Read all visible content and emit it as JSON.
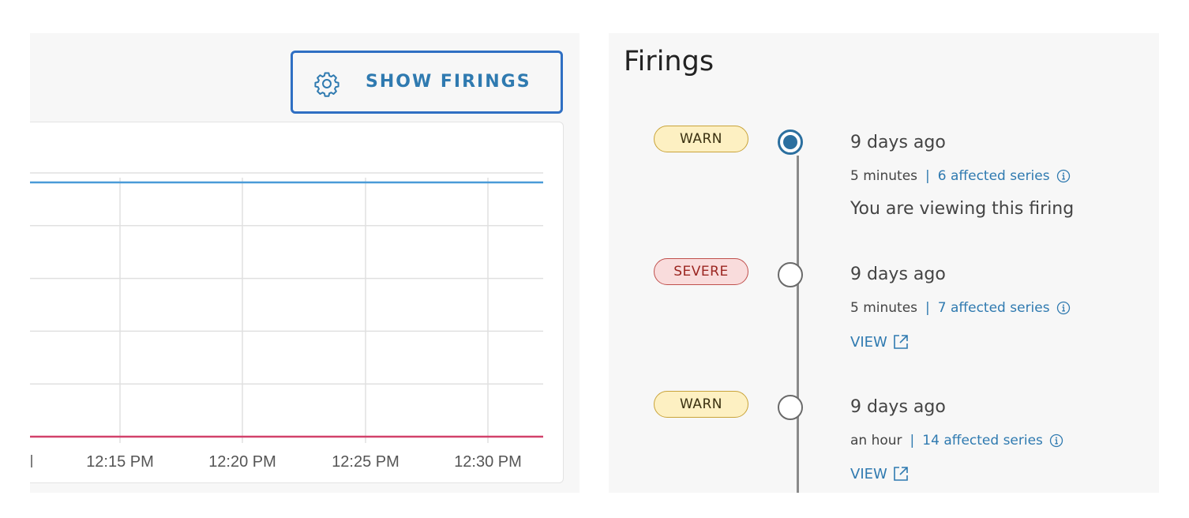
{
  "left": {
    "show_firings_label": "SHOW FIRINGS",
    "show_firings_icon": "gear-icon"
  },
  "chart_data": {
    "type": "line",
    "x_tick_labels": [
      "12:15 PM",
      "12:20 PM",
      "12:25 PM",
      "12:30 PM"
    ],
    "series": [
      {
        "color": "#4a9bd8",
        "values": [
          1,
          1,
          1,
          1,
          1
        ]
      },
      {
        "color": "#d2416b",
        "values": [
          0,
          0,
          0,
          0,
          0
        ]
      }
    ],
    "grid": true
  },
  "right": {
    "title": "Firings",
    "firings": [
      {
        "severity": "WARN",
        "time_ago": "9 days ago",
        "duration": "5 minutes",
        "affected": "6 affected series",
        "status_text": "You are viewing this firing",
        "active": true
      },
      {
        "severity": "SEVERE",
        "time_ago": "9 days ago",
        "duration": "5 minutes",
        "affected": "7 affected series",
        "view_label": "VIEW",
        "active": false
      },
      {
        "severity": "WARN",
        "time_ago": "9 days ago",
        "duration": "an hour",
        "affected": "14 affected series",
        "view_label": "VIEW",
        "active": false
      }
    ],
    "separator": "|",
    "colors": {
      "accent": "#2f7ab0",
      "warn_bg": "#fdf0c2",
      "severe_bg": "#f9dcdc",
      "active_dot": "#2b6f9f"
    }
  }
}
